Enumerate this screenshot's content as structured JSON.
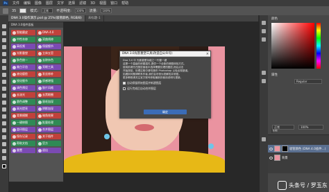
{
  "menubar": {
    "logo": "Ps",
    "items": [
      "文件",
      "编辑",
      "图像",
      "图层",
      "文字",
      "选择",
      "滤镜",
      "3D",
      "视图",
      "窗口",
      "帮助"
    ]
  },
  "options": {
    "size_label": "35",
    "mode_label": "模式:",
    "mode_value": "正常",
    "opacity_label": "不透明度:",
    "opacity_value": "100%",
    "flow_label": "流量:",
    "flow_value": "100%"
  },
  "tabs": [
    {
      "label": "DNA 3.0操作演示.psd @ 25%(吸管颜色, RGB/8)",
      "active": true
    },
    {
      "label": "未标题-1",
      "active": false
    }
  ],
  "plugin": {
    "title": "DNA 3.0插件面板",
    "buttons": [
      {
        "label": "智能磨皮",
        "color": "red"
      },
      {
        "label": "DNA 4.0",
        "color": "red"
      },
      {
        "label": "中性灰修",
        "color": "green"
      },
      {
        "label": "双曲线修",
        "color": "green"
      },
      {
        "label": "高低频",
        "color": "purple"
      },
      {
        "label": "保留细节",
        "color": "purple"
      },
      {
        "label": "光影重塑",
        "color": "red"
      },
      {
        "label": "立体五官",
        "color": "red"
      },
      {
        "label": "肤色统一",
        "color": "green"
      },
      {
        "label": "去除杂色",
        "color": "green"
      },
      {
        "label": "美白牙齿",
        "color": "purple"
      },
      {
        "label": "亮眼工具",
        "color": "purple"
      },
      {
        "label": "液化瘦脸",
        "color": "red"
      },
      {
        "label": "发丝修补",
        "color": "red"
      },
      {
        "label": "锐化细节",
        "color": "green"
      },
      {
        "label": "质感增强",
        "color": "green"
      },
      {
        "label": "调色预设",
        "color": "purple"
      },
      {
        "label": "胶片风格",
        "color": "purple"
      },
      {
        "label": "去油光",
        "color": "red"
      },
      {
        "label": "去黑眼圈",
        "color": "red"
      },
      {
        "label": "唇色调整",
        "color": "green"
      },
      {
        "label": "眉毛加深",
        "color": "green"
      },
      {
        "label": "高光提亮",
        "color": "purple"
      },
      {
        "label": "阴影加深",
        "color": "purple"
      },
      {
        "label": "背景模糊",
        "color": "red"
      },
      {
        "label": "暗角效果",
        "color": "red"
      },
      {
        "label": "一键修图",
        "color": "green"
      },
      {
        "label": "批量处理",
        "color": "green"
      },
      {
        "label": "盖印图层",
        "color": "purple"
      },
      {
        "label": "合并图层",
        "color": "purple"
      },
      {
        "label": "保存记录",
        "color": "red"
      },
      {
        "label": "关于插件",
        "color": "red"
      },
      {
        "label": "帮助文档",
        "color": "green"
      },
      {
        "label": "官方",
        "color": "green"
      },
      {
        "label": "重置",
        "color": "purple"
      },
      {
        "label": "退出",
        "color": "purple"
      }
    ]
  },
  "dialog": {
    "title": "DNA 3.0光影重塑工具(改造自公众号)",
    "lines": [
      "Dna 3.0 中 光影重塑功能之一代替一键",
      "这是一个高级的修图插件,提供一个全新的修图体验方式。",
      "使用前请先在图层面板中选择需要处理的图层,然后点击",
      "开始按钮。处理过程中请勿操作 Photoshop 以免出现错误。",
      "",
      "如遇到问题请联系作者,我们会尽快为您解答并修复。",
      "更多教程请关注官方账号获取最新的使用说明与更新。"
    ],
    "check1": "自动保留原始图层并新建图层",
    "check2": "运行完成后自动合并图层",
    "ok": "确定"
  },
  "right_panel": {
    "color_title": "颜色",
    "props_title": "属性",
    "props_value": "Regular",
    "layers_title": "图层",
    "blend_value": "正常",
    "opacity_value": "100%",
    "layers": [
      {
        "name": "吸管颜色 (DNA 4.0插件...)",
        "selected": true
      },
      {
        "name": "背景",
        "selected": false
      }
    ]
  },
  "watermark": {
    "text": "头条号 / 罗玉东"
  }
}
